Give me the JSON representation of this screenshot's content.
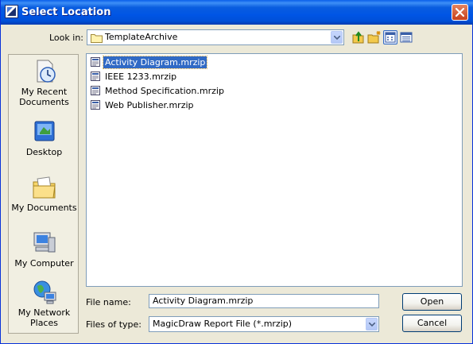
{
  "window": {
    "title": "Select Location"
  },
  "look_in": {
    "label": "Look in:",
    "value": "TemplateArchive"
  },
  "toolbar": {
    "icons": [
      "up-one-level-icon",
      "new-folder-icon",
      "list-view-icon",
      "details-view-icon"
    ]
  },
  "places": [
    {
      "name": "my-recent-documents",
      "label": "My Recent Documents",
      "line1": "My Recent",
      "line2": "Documents"
    },
    {
      "name": "desktop",
      "label": "Desktop",
      "line1": "Desktop",
      "line2": ""
    },
    {
      "name": "my-documents",
      "label": "My Documents",
      "line1": "My Documents",
      "line2": ""
    },
    {
      "name": "my-computer",
      "label": "My Computer",
      "line1": "My Computer",
      "line2": ""
    },
    {
      "name": "my-network-places",
      "label": "My Network Places",
      "line1": "My Network",
      "line2": "Places"
    }
  ],
  "files": [
    {
      "name": "Activity Diagram.mrzip",
      "selected": true
    },
    {
      "name": "IEEE 1233.mrzip",
      "selected": false
    },
    {
      "name": "Method Specification.mrzip",
      "selected": false
    },
    {
      "name": "Web Publisher.mrzip",
      "selected": false
    }
  ],
  "file_name": {
    "label": "File name:",
    "value": "Activity Diagram.mrzip"
  },
  "file_type": {
    "label": "Files of type:",
    "value": "MagicDraw Report File (*.mrzip)"
  },
  "buttons": {
    "open": "Open",
    "cancel": "Cancel"
  },
  "colors": {
    "titlebar": "#0055E5",
    "selection": "#316AC5",
    "dialog_bg": "#ECE9D8",
    "close_button": "#C8401C"
  }
}
